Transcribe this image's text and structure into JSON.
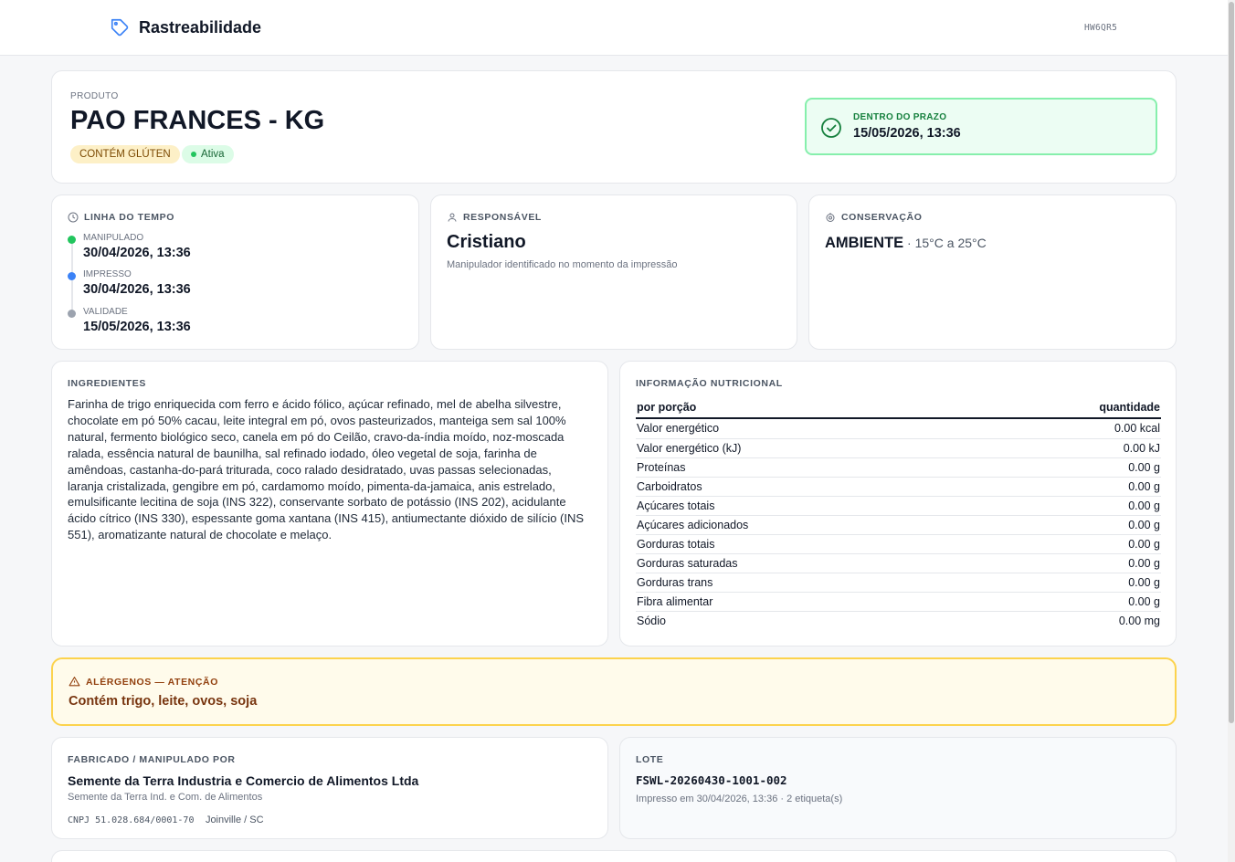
{
  "header": {
    "title": "Rastreabilidade",
    "code": "HW6QR5"
  },
  "product": {
    "label": "PRODUTO",
    "name": "PAO FRANCES - KG",
    "gluten_badge": "CONTÉM GLÚTEN",
    "status_badge": "Ativa",
    "validity_status": "DENTRO DO PRAZO",
    "validity_date": "15/05/2026, 13:36"
  },
  "timeline": {
    "label": "LINHA DO TEMPO",
    "items": [
      {
        "label": "MANIPULADO",
        "value": "30/04/2026, 13:36",
        "color": "#22c55e"
      },
      {
        "label": "IMPRESSO",
        "value": "30/04/2026, 13:36",
        "color": "#3b82f6"
      },
      {
        "label": "VALIDADE",
        "value": "15/05/2026, 13:36",
        "color": "#9ca3af"
      }
    ]
  },
  "responsible": {
    "label": "RESPONSÁVEL",
    "name": "Cristiano",
    "note": "Manipulador identificado no momento da impressão"
  },
  "conservation": {
    "label": "CONSERVAÇÃO",
    "type": "AMBIENTE",
    "range": " · 15°C a 25°C"
  },
  "ingredients": {
    "label": "INGREDIENTES",
    "text": "Farinha de trigo enriquecida com ferro e ácido fólico, açúcar refinado, mel de abelha silvestre, chocolate em pó 50% cacau, leite integral em pó, ovos pasteurizados, manteiga sem sal 100% natural, fermento biológico seco, canela em pó do Ceilão, cravo-da-índia moído, noz-moscada ralada, essência natural de baunilha, sal refinado iodado, óleo vegetal de soja, farinha de amêndoas, castanha-do-pará triturada, coco ralado desidratado, uvas passas selecionadas, laranja cristalizada, gengibre em pó, cardamomo moído, pimenta-da-jamaica, anis estrelado, emulsificante lecitina de soja (INS 322), conservante sorbato de potássio (INS 202), acidulante ácido cítrico (INS 330), espessante goma xantana (INS 415), antiumectante dióxido de silício (INS 551), aromatizante natural de chocolate e melaço."
  },
  "nutrition": {
    "label": "INFORMAÇÃO NUTRICIONAL",
    "col_name": "por porção",
    "col_value": "quantidade",
    "rows": [
      {
        "name": "Valor energético",
        "value": "0.00 kcal"
      },
      {
        "name": "Valor energético (kJ)",
        "value": "0.00 kJ"
      },
      {
        "name": "Proteínas",
        "value": "0.00 g"
      },
      {
        "name": "Carboidratos",
        "value": "0.00 g"
      },
      {
        "name": "Açúcares totais",
        "value": "0.00 g"
      },
      {
        "name": "Açúcares adicionados",
        "value": "0.00 g"
      },
      {
        "name": "Gorduras totais",
        "value": "0.00 g"
      },
      {
        "name": "Gorduras saturadas",
        "value": "0.00 g"
      },
      {
        "name": "Gorduras trans",
        "value": "0.00 g"
      },
      {
        "name": "Fibra alimentar",
        "value": "0.00 g"
      },
      {
        "name": "Sódio",
        "value": "0.00 mg"
      }
    ]
  },
  "allergens": {
    "label": "ALÉRGENOS — ATENÇÃO",
    "text": "Contém trigo, leite, ovos, soja"
  },
  "manufacturer": {
    "label": "FABRICADO / MANIPULADO POR",
    "name": "Semente da Terra Industria e Comercio de Alimentos Ltda",
    "trade_name": "Semente da Terra Ind. e Com. de Alimentos",
    "cnpj": "CNPJ 51.028.684/0001-70",
    "city": "Joinville / SC"
  },
  "lot": {
    "label": "LOTE",
    "code": "FSWL-20260430-1001-002",
    "printed": "Impresso em 30/04/2026, 13:36 · 2 etiqueta(s)"
  }
}
